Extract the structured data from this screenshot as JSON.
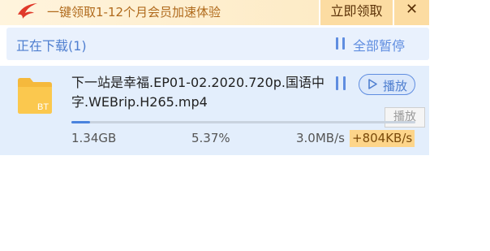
{
  "promo": {
    "text": "一键领取1-12个月会员加速体验",
    "claim_button": "立即领取",
    "close_glyph": "✕"
  },
  "downloading": {
    "title": "正在下载(1)",
    "pause_all": "全部暂停"
  },
  "task": {
    "file_name": "下一站是幸福.EP01-02.2020.720p.国语中字.WEBrip.H265.mp4",
    "file_badge": "BT",
    "file_icon": "folder-bt-icon",
    "play_label": "播放",
    "tooltip": "播放",
    "progress_percent": 5.37,
    "size": "1.34GB",
    "percent_text": "5.37%",
    "speed": "3.0MB/s",
    "boost_speed": "+804KB/s"
  },
  "colors": {
    "accent": "#4f7fd0",
    "promo_text": "#b06a1c",
    "promo_button_bg": "#fcdca2",
    "boost_bg": "#fdd58a"
  }
}
